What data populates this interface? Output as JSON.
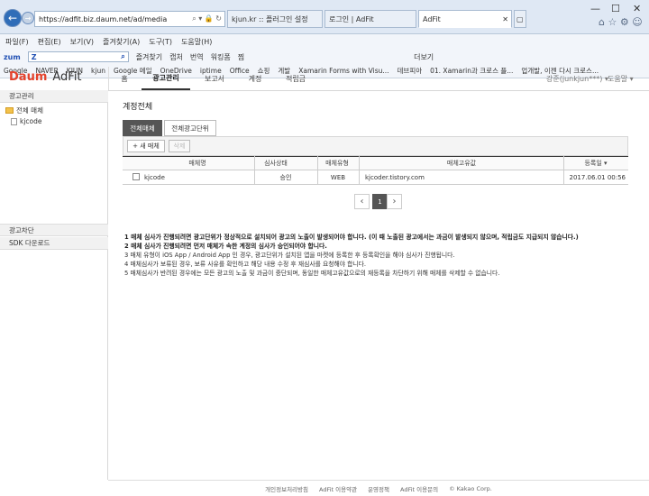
{
  "browser": {
    "address": "https://adfit.biz.daum.net/ad/media",
    "tabs": [
      "kjun.kr :: 플러그인 설정",
      "로그인 | AdFit",
      "AdFit"
    ],
    "menu": [
      "파일(F)",
      "편집(E)",
      "보기(V)",
      "즐겨찾기(A)",
      "도구(T)",
      "도움말(H)"
    ],
    "cmd": {
      "zum": "zum",
      "zum_value": "Z",
      "items": [
        "즐겨찾기",
        "캡처",
        "번역",
        "워킹폼",
        "찜",
        "더보기"
      ]
    },
    "favorites": [
      "Google",
      "NAVER",
      "KJUN",
      "kjun",
      "Google 메일",
      "OneDrive",
      "iptime",
      "Office",
      "쇼핑",
      "게발",
      "Xamarin Forms with Visu...",
      "데브피아",
      "01. Xamarin과 크로스 플...",
      "업개발, 이젠 다시 크로스..."
    ]
  },
  "header": {
    "logo_daum": "Daum",
    "logo_adfit": "AdFit",
    "nav": [
      "홈",
      "광고관리",
      "보고서",
      "계정",
      "적립금"
    ],
    "user": "강준(junkjun***)",
    "help": "도움말"
  },
  "sidebar": {
    "section1": "광고관리",
    "tree_root": "전체 매체",
    "tree_child": "kjcode",
    "section2": "광고차단",
    "section3": "SDK 다운로드"
  },
  "main": {
    "title": "계정전체",
    "tabs": [
      "전체매체",
      "전체광고단위"
    ],
    "buttons": {
      "new_media": "+ 새 매체",
      "delete": "삭제"
    },
    "columns": [
      "매체명",
      "심사상태",
      "매체유형",
      "매체고유값",
      "등록일"
    ],
    "rows": [
      {
        "name": "kjcode",
        "status": "승인",
        "type": "WEB",
        "uid": "kjcoder.tistory.com",
        "date": "2017.06.01 00:56"
      }
    ],
    "pagination": {
      "prev": "‹",
      "current": "1",
      "next": "›"
    },
    "notes": [
      "1  매체 심사가 진행되려면 광고단위가 정상적으로 설치되어 광고의 노출이 발생되어야 합니다. (이 때 노출된 광고에서는 과금이 발생되지 않으며, 적립금도 지급되지 않습니다.)",
      "2  매체 심사가 진행되려면 먼저 매체가 속한 계정의 심사가 승인되어야 합니다.",
      "3  매체 유형이 iOS App / Android App 인 경우, 광고단위가 설치된 앱을 마켓에 등록한 후 등록확인을 해야 심사가 진행됩니다.",
      "4  매체심사가 보류된 경우, 보류 사유를 확인하고 해당 내용 수정 후 재심사를 요청해야 합니다.",
      "5  매체심사가 반려된 경우에는 모든 광고의 노출 및 과금이 중단되며, 동일한 매체고유값으로의 재등록을 차단하기 위해 매체를 삭제할 수 없습니다."
    ]
  },
  "footer": [
    "개인정보처리방침",
    "AdFit 이용약관",
    "운영정책",
    "AdFit 이용문의",
    "© Kakao Corp."
  ]
}
